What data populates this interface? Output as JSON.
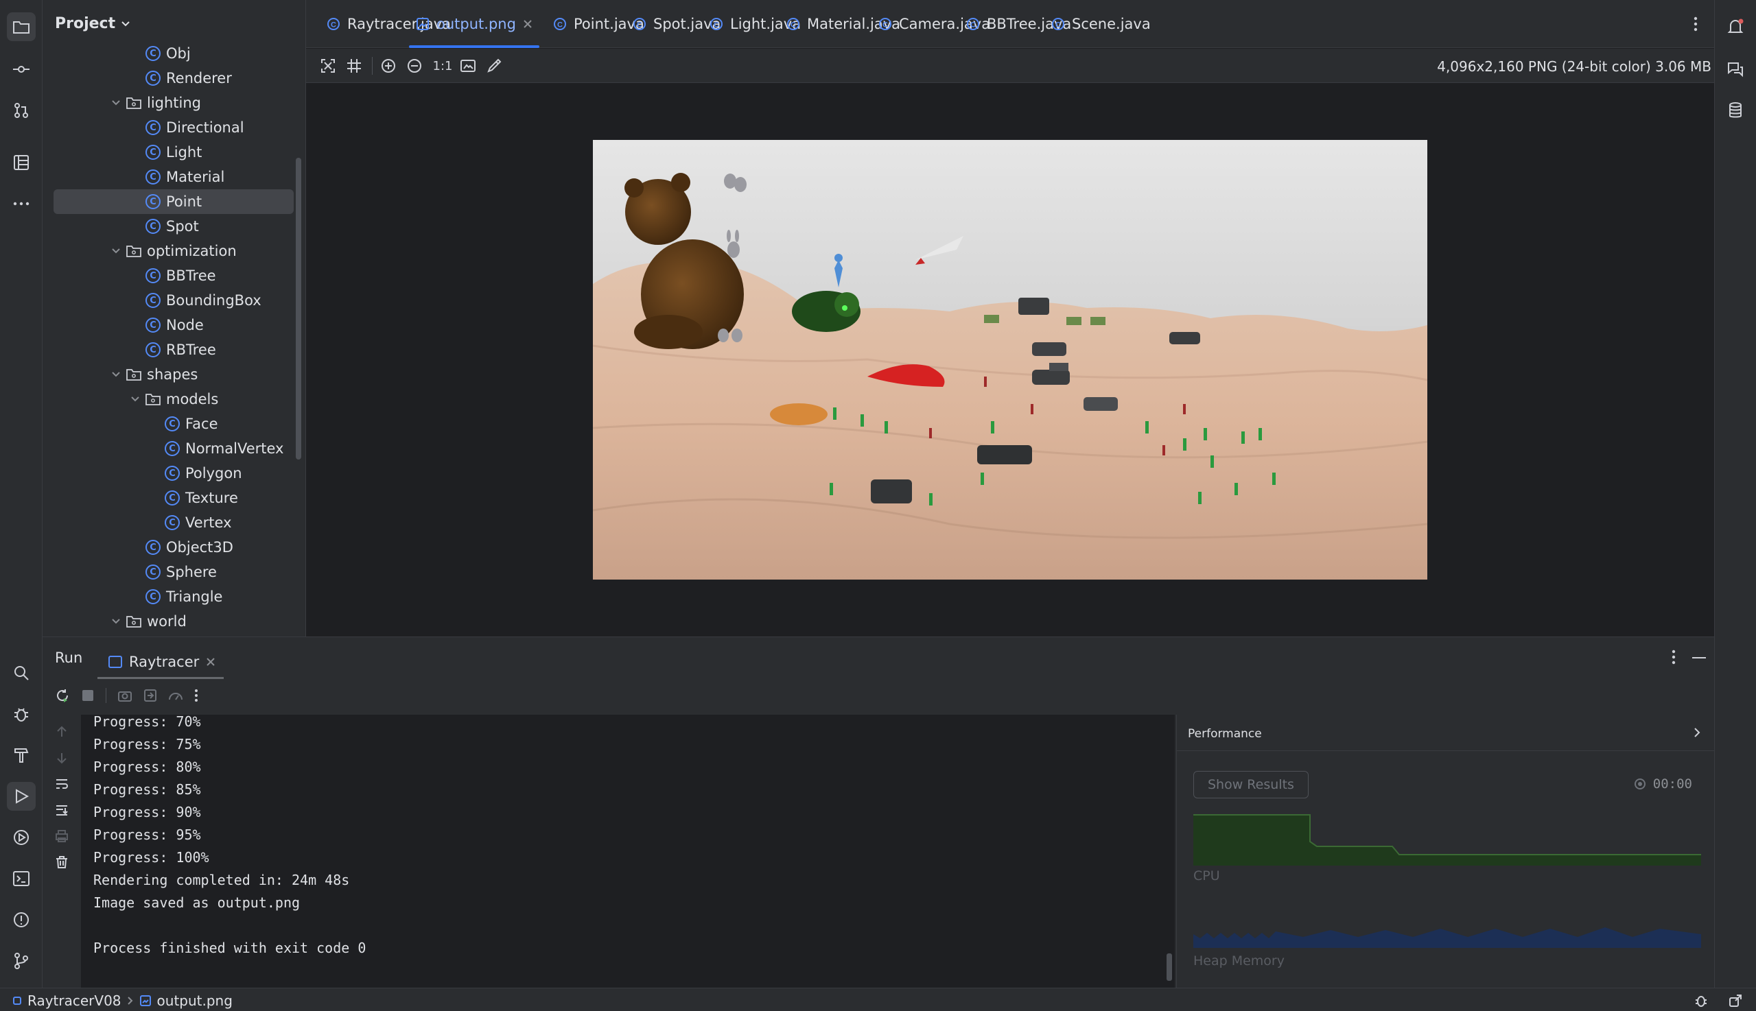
{
  "project": {
    "title": "Project",
    "tree": [
      {
        "label": "Obj",
        "type": "class",
        "depth": 2
      },
      {
        "label": "Renderer",
        "type": "class",
        "depth": 2
      },
      {
        "label": "lighting",
        "type": "folder",
        "depth": 1
      },
      {
        "label": "Directional",
        "type": "class",
        "depth": 2
      },
      {
        "label": "Light",
        "type": "class",
        "depth": 2
      },
      {
        "label": "Material",
        "type": "class",
        "depth": 2
      },
      {
        "label": "Point",
        "type": "class",
        "depth": 2,
        "selected": true
      },
      {
        "label": "Spot",
        "type": "class",
        "depth": 2
      },
      {
        "label": "optimization",
        "type": "folder",
        "depth": 1
      },
      {
        "label": "BBTree",
        "type": "class",
        "depth": 2
      },
      {
        "label": "BoundingBox",
        "type": "class",
        "depth": 2
      },
      {
        "label": "Node",
        "type": "class",
        "depth": 2
      },
      {
        "label": "RBTree",
        "type": "class",
        "depth": 2
      },
      {
        "label": "shapes",
        "type": "folder",
        "depth": 1
      },
      {
        "label": "models",
        "type": "folder",
        "depth": 2
      },
      {
        "label": "Face",
        "type": "class",
        "depth": 3
      },
      {
        "label": "NormalVertex",
        "type": "class",
        "depth": 3
      },
      {
        "label": "Polygon",
        "type": "class",
        "depth": 3
      },
      {
        "label": "Texture",
        "type": "class",
        "depth": 3
      },
      {
        "label": "Vertex",
        "type": "class",
        "depth": 3
      },
      {
        "label": "Object3D",
        "type": "class",
        "depth": 2
      },
      {
        "label": "Sphere",
        "type": "class",
        "depth": 2
      },
      {
        "label": "Triangle",
        "type": "class",
        "depth": 2
      },
      {
        "label": "world",
        "type": "folder",
        "depth": 1
      }
    ]
  },
  "tabs": [
    {
      "label": "Raytracer.java",
      "icon": "java-class-icon"
    },
    {
      "label": "output.png",
      "icon": "image-file-icon",
      "active": true,
      "closable": true
    },
    {
      "label": "Point.java",
      "icon": "java-class-icon"
    },
    {
      "label": "Spot.java",
      "icon": "java-class-icon"
    },
    {
      "label": "Light.java",
      "icon": "java-class-icon"
    },
    {
      "label": "Material.java",
      "icon": "java-class-icon"
    },
    {
      "label": "Camera.java",
      "icon": "java-class-icon"
    },
    {
      "label": "BBTree.java",
      "icon": "java-class-icon"
    },
    {
      "label": "Scene.java",
      "icon": "java-class-icon"
    }
  ],
  "image_viewer": {
    "zoom_actual_label": "1:1",
    "info": "4,096x2,160 PNG (24-bit color) 3.06 MB"
  },
  "run": {
    "title": "Run",
    "config_tab": "Raytracer",
    "console_lines": [
      "Progress: 70%",
      "Progress: 75%",
      "Progress: 80%",
      "Progress: 85%",
      "Progress: 90%",
      "Progress: 95%",
      "Progress: 100%",
      "Rendering completed in: 24m 48s",
      "Image saved as output.png",
      "",
      "Process finished with exit code 0"
    ]
  },
  "performance": {
    "title": "Performance",
    "show_results": "Show Results",
    "timer": "00:00",
    "cpu_label": "CPU",
    "heap_label": "Heap Memory"
  },
  "status": {
    "project": "RaytracerV08",
    "file": "output.png"
  },
  "colors": {
    "accent": "#3574f0",
    "class_icon": "#548af7"
  }
}
